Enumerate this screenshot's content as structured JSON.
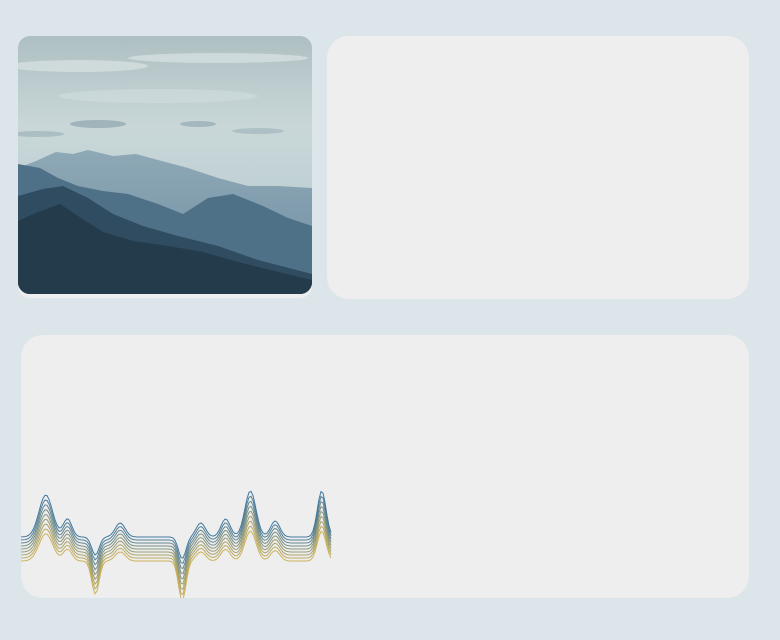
{
  "cards": [
    {
      "id": "photo",
      "content": "mountain-landscape-image"
    },
    {
      "id": "blank",
      "content": "empty"
    },
    {
      "id": "wave",
      "content": "layered-wave-lines-graphic"
    }
  ],
  "colors": {
    "background": "#dce5e9",
    "card": "#eeeeee",
    "sky_top": "#cad7da",
    "mountain_dark": "#233b4b",
    "wave_blue": "#2e6b96",
    "wave_gold": "#c9ab4a"
  }
}
